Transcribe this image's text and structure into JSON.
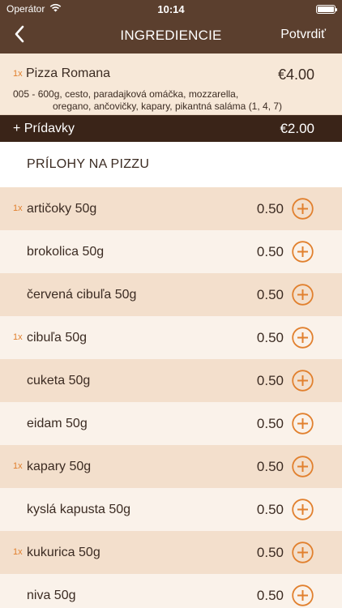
{
  "status_bar": {
    "carrier": "Operátor",
    "time": "10:14"
  },
  "nav": {
    "title": "INGREDIENCIE",
    "confirm_label": "Potvrdiť"
  },
  "pizza": {
    "qty": "1x",
    "name": "Pizza Romana",
    "price": "€4.00",
    "code": "005 -",
    "ingredients_line1": "600g, cesto, paradajková omáčka, mozzarella,",
    "ingredients_line2": "oregano, ančovičky, kapary, pikantná saláma (1, 4, 7)"
  },
  "extras": {
    "label": "+ Prídavky",
    "price": "€2.00"
  },
  "section": {
    "title": "PRÍLOHY NA PIZZU"
  },
  "items": [
    {
      "qty": "1x",
      "name": "artičoky 50g",
      "price": "0.50"
    },
    {
      "qty": "",
      "name": "brokolica 50g",
      "price": "0.50"
    },
    {
      "qty": "",
      "name": "červená cibuľa 50g",
      "price": "0.50"
    },
    {
      "qty": "1x",
      "name": "cibuľa 50g",
      "price": "0.50"
    },
    {
      "qty": "",
      "name": "cuketa 50g",
      "price": "0.50"
    },
    {
      "qty": "",
      "name": "eidam 50g",
      "price": "0.50"
    },
    {
      "qty": "1x",
      "name": "kapary 50g",
      "price": "0.50"
    },
    {
      "qty": "",
      "name": "kyslá kapusta 50g",
      "price": "0.50"
    },
    {
      "qty": "1x",
      "name": "kukurica 50g",
      "price": "0.50"
    },
    {
      "qty": "",
      "name": "niva 50g",
      "price": "0.50"
    }
  ],
  "colors": {
    "header_brown": "#5b3f2e",
    "extras_dark": "#3a2418",
    "accent_orange": "#e1802e"
  },
  "icons": {
    "back": "chevron-left-icon",
    "add": "plus-circle-icon",
    "wifi": "wifi-icon",
    "battery": "battery-icon"
  }
}
